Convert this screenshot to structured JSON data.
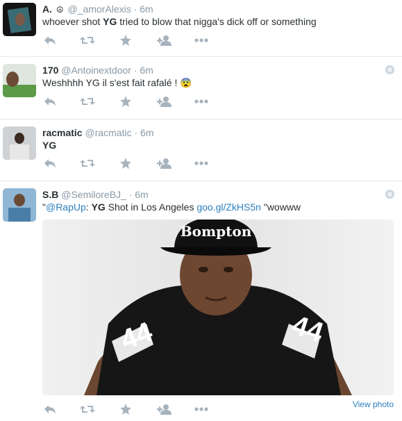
{
  "tweets": [
    {
      "name": "A.",
      "verified_glyph": "☮",
      "handle": "@_amorAlexis",
      "separator": "·",
      "time": "6m",
      "text_before": "whoever shot ",
      "text_bold": "YG",
      "text_after": " tried to blow that nigga's dick off or something",
      "avatar_color": "#1a1a1a"
    },
    {
      "name": "170",
      "handle": "@Antoinextdoor",
      "separator": "·",
      "time": "6m",
      "text": "Weshhhh YG il s'est fait rafalé ! 😨",
      "avatar_color": "#6ea35a",
      "globe_icon": "globe-icon"
    },
    {
      "name": "racmatic",
      "handle": "@racmatic",
      "separator": "·",
      "time": "6m",
      "text": "YG",
      "avatar_color": "#444444"
    },
    {
      "name": "S.B",
      "handle": "@SemiloreBJ_",
      "separator": "·",
      "time": "6m",
      "text_quote_open": "\"",
      "mention": "@RapUp",
      "text_colon": ": ",
      "text_bold": "YG",
      "text_mid": " Shot in Los Angeles ",
      "url": "goo.gl/ZkHS5n",
      "text_end": " \"wowww",
      "avatar_color": "#7fa8c9",
      "globe_icon": "globe-icon",
      "photo": {
        "cap_text": "Bompton",
        "jersey_number": "44",
        "view_label": "View photo"
      }
    }
  ],
  "actions": [
    "reply-icon",
    "retweet-icon",
    "favorite-icon",
    "follow-icon",
    "more-icon"
  ],
  "colors": {
    "text": "#292f33",
    "muted": "#8899a6",
    "link": "#2a7fbd",
    "action_icon": "#a7b3bd",
    "divider": "#e1e8ed"
  }
}
